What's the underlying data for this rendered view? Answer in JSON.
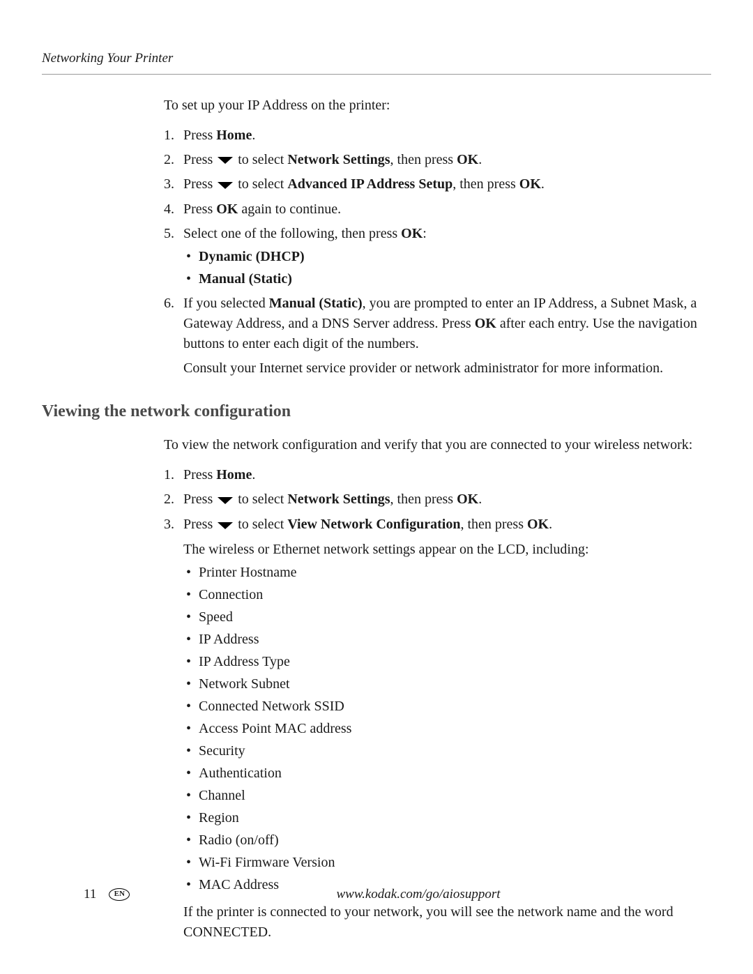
{
  "header": {
    "section_title": "Networking Your Printer"
  },
  "section1": {
    "intro": "To set up your IP Address on the printer:",
    "step1_pre": "Press ",
    "step1_bold": "Home",
    "step1_post": ".",
    "step2_pre": "Press ",
    "step2_mid": " to select ",
    "step2_bold1": "Network Settings",
    "step2_mid2": ", then press ",
    "step2_bold2": "OK",
    "step2_post": ".",
    "step3_pre": "Press ",
    "step3_mid": " to select ",
    "step3_bold1": "Advanced IP Address Setup",
    "step3_mid2": ", then press ",
    "step3_bold2": "OK",
    "step3_post": ".",
    "step4_pre": "Press ",
    "step4_bold": "OK",
    "step4_post": " again to continue.",
    "step5_pre": "Select one of the following, then press ",
    "step5_bold": "OK",
    "step5_post": ":",
    "step5_opt1": "Dynamic (DHCP)",
    "step5_opt2": "Manual (Static)",
    "step6_pre": "If you selected ",
    "step6_bold1": "Manual (Static)",
    "step6_mid1": ", you are prompted to enter an IP Address, a Subnet Mask, a Gateway Address, and a DNS Server address. Press ",
    "step6_bold2": "OK",
    "step6_mid2": " after each entry. Use the navigation buttons to enter each digit of the numbers.",
    "step6_para2": "Consult your Internet service provider or network administrator for more information."
  },
  "heading2": "Viewing the network configuration",
  "section2": {
    "intro": "To view the network configuration and verify that you are connected to your wireless network:",
    "step1_pre": "Press ",
    "step1_bold": "Home",
    "step1_post": ".",
    "step2_pre": "Press ",
    "step2_mid": " to select ",
    "step2_bold1": "Network Settings",
    "step2_mid2": ", then press ",
    "step2_bold2": "OK",
    "step2_post": ".",
    "step3_pre": "Press ",
    "step3_mid": " to select ",
    "step3_bold1": "View Network Configuration",
    "step3_mid2": ", then press ",
    "step3_bold2": "OK",
    "step3_post": ".",
    "step3_para": "The wireless or Ethernet network settings appear on the LCD, including:",
    "bullets": [
      "Printer Hostname",
      "Connection",
      "Speed",
      "IP Address",
      "IP Address Type",
      "Network Subnet",
      "Connected Network SSID",
      "Access Point MAC address",
      "Security",
      "Authentication",
      "Channel",
      "Region",
      "Radio (on/off)",
      "Wi-Fi Firmware Version",
      "MAC Address"
    ],
    "closing": "If the printer is connected to your network, you will see the network name and the word CONNECTED."
  },
  "footer": {
    "page_number": "11",
    "lang": "EN",
    "url": "www.kodak.com/go/aiosupport"
  }
}
